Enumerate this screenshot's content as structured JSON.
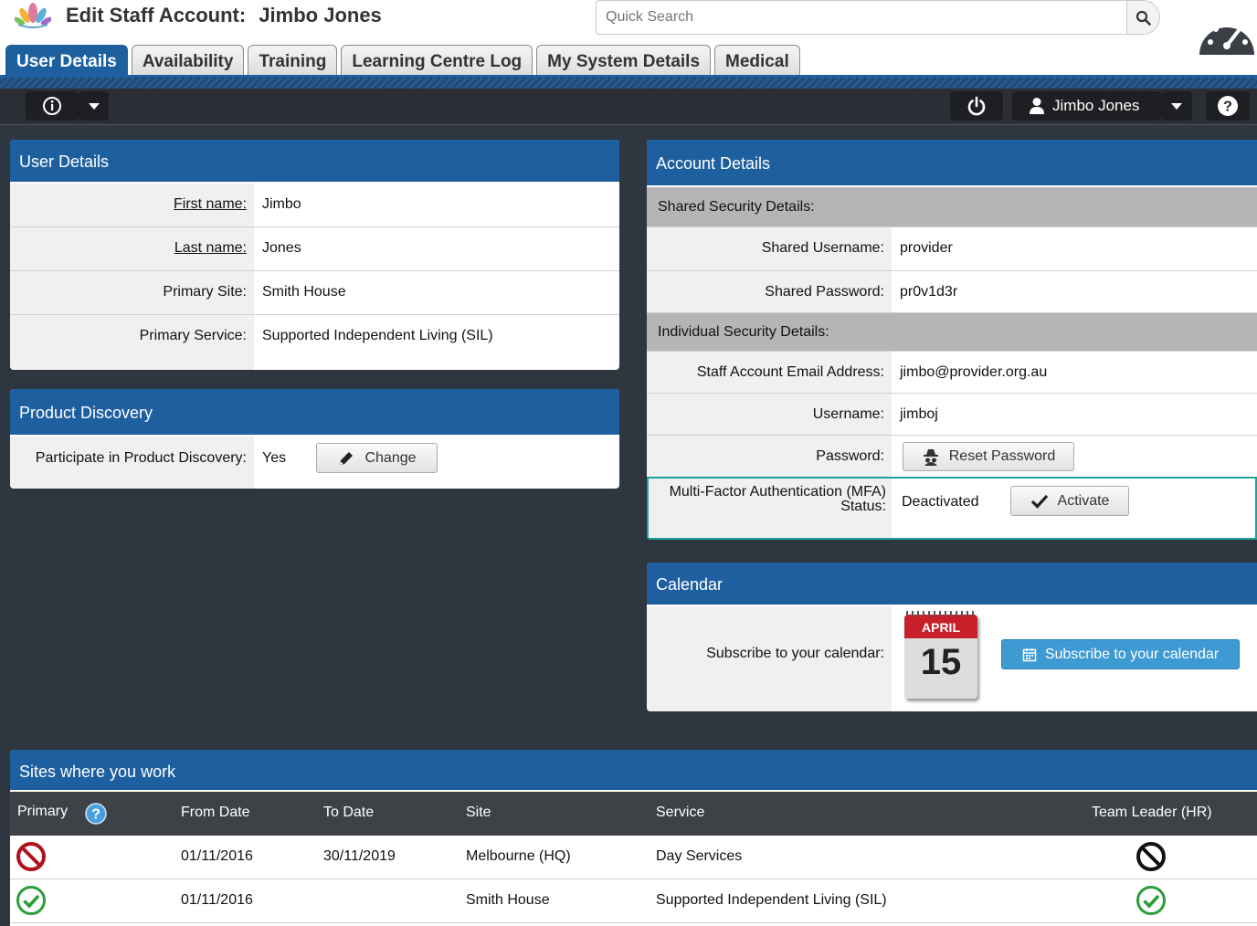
{
  "header": {
    "title_prefix": "Edit Staff Account:",
    "title_name": "Jimbo Jones",
    "search_placeholder": "Quick Search"
  },
  "tabs": [
    {
      "label": "User Details",
      "active": true
    },
    {
      "label": "Availability",
      "active": false
    },
    {
      "label": "Training",
      "active": false
    },
    {
      "label": "Learning Centre Log",
      "active": false
    },
    {
      "label": "My System Details",
      "active": false
    },
    {
      "label": "Medical",
      "active": false
    }
  ],
  "toolbar": {
    "user_name": "Jimbo Jones"
  },
  "user_details": {
    "title": "User Details",
    "rows": [
      {
        "label": "First name:",
        "value": "Jimbo"
      },
      {
        "label": "Last name:",
        "value": "Jones"
      },
      {
        "label": "Primary Site:",
        "value": "Smith House"
      },
      {
        "label": "Primary Service:",
        "value": "Supported Independent Living (SIL)"
      }
    ]
  },
  "product_discovery": {
    "title": "Product Discovery",
    "label": "Participate in Product Discovery:",
    "value": "Yes",
    "button": "Change"
  },
  "account_details": {
    "title": "Account Details",
    "shared_section": "Shared Security Details:",
    "shared_username_label": "Shared Username:",
    "shared_username": "provider",
    "shared_password_label": "Shared Password:",
    "shared_password": "pr0v1d3r",
    "individual_section": "Individual Security Details:",
    "email_label": "Staff Account Email Address:",
    "email": "jimbo@provider.org.au",
    "username_label": "Username:",
    "username": "jimboj",
    "password_label": "Password:",
    "reset_button": "Reset Password",
    "mfa_label_1": "Multi-Factor Authentication (MFA)",
    "mfa_label_2": "Status:",
    "mfa_status": "Deactivated",
    "activate_button": "Activate"
  },
  "calendar": {
    "title": "Calendar",
    "label": "Subscribe to your calendar:",
    "icon_month": "APRIL",
    "icon_day": "15",
    "button": "Subscribe to your calendar"
  },
  "sites": {
    "title": "Sites where you work",
    "columns": [
      "Primary",
      "From Date",
      "To Date",
      "Site",
      "Service",
      "Team Leader (HR)"
    ],
    "rows": [
      {
        "primary": false,
        "from": "01/11/2016",
        "to": "30/11/2019",
        "site": "Melbourne (HQ)",
        "service": "Day Services",
        "team_leader": false
      },
      {
        "primary": true,
        "from": "01/11/2016",
        "to": "",
        "site": "Smith House",
        "service": "Supported Independent Living (SIL)",
        "team_leader": true
      }
    ]
  },
  "colors": {
    "header_blue": "#1e5fa0",
    "background": "#2e3640",
    "button_blue": "#3e9ad2",
    "mfa_highlight": "#1aa39a",
    "no_red": "#b0121b",
    "yes_green": "#2a9d3a"
  }
}
